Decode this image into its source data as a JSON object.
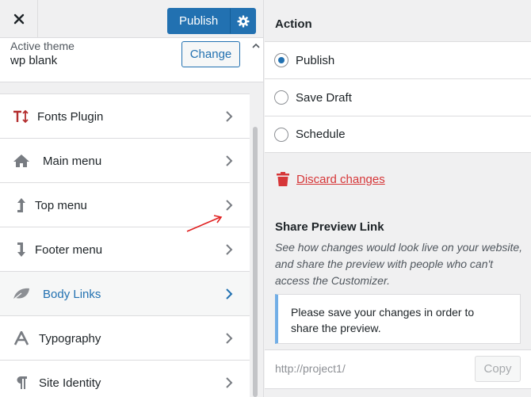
{
  "header": {
    "publish_label": "Publish"
  },
  "theme": {
    "label": "Active theme",
    "name": "wp blank",
    "change_label": "Change"
  },
  "menu": {
    "items": [
      {
        "label": "Fonts Plugin",
        "icon": "fonts-icon"
      },
      {
        "label": "Main menu",
        "icon": "home-icon"
      },
      {
        "label": "Top menu",
        "icon": "arrow-up-icon"
      },
      {
        "label": "Footer menu",
        "icon": "arrow-down-icon"
      },
      {
        "label": "Body Links",
        "icon": "leaf-icon",
        "active": true
      },
      {
        "label": "Typography",
        "icon": "typography-icon"
      },
      {
        "label": "Site Identity",
        "icon": "paragraph-icon"
      }
    ]
  },
  "action": {
    "title": "Action",
    "options": [
      {
        "label": "Publish",
        "checked": true
      },
      {
        "label": "Save Draft",
        "checked": false
      },
      {
        "label": "Schedule",
        "checked": false
      }
    ],
    "discard_label": "Discard changes"
  },
  "share": {
    "title": "Share Preview Link",
    "description": "See how changes would look live on your website, and share the preview with people who can't access the Customizer.",
    "notice_line1": "Please save your changes in order to",
    "notice_line2": "share the preview.",
    "url": "http://project1/",
    "copy_label": "Copy"
  },
  "colors": {
    "accent": "#2271b1",
    "danger": "#d63638",
    "annotation": "#e02020"
  }
}
